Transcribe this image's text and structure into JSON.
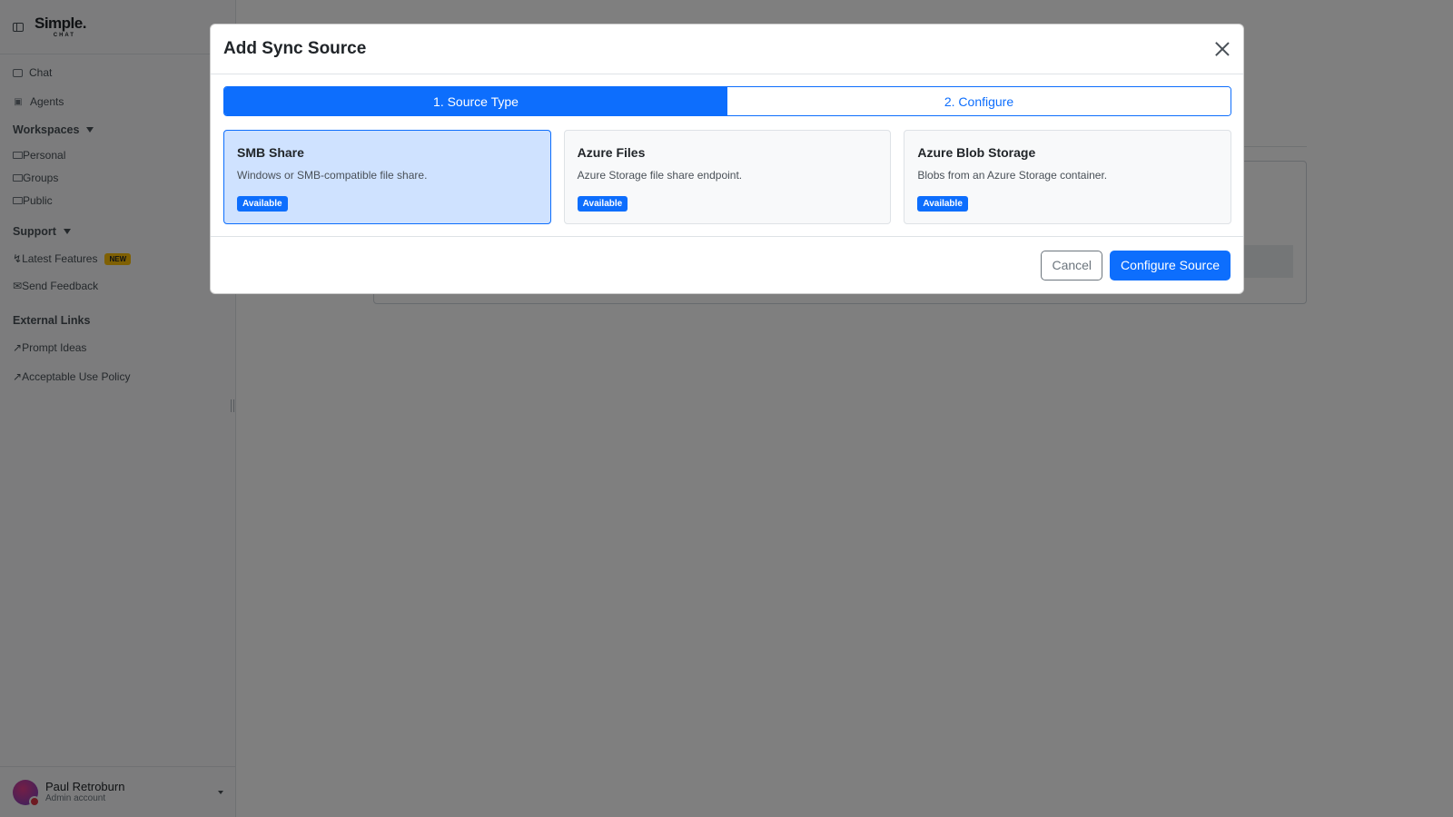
{
  "sidebar": {
    "logo_main": "Simple.",
    "logo_sub": "CHAT",
    "nav": [
      {
        "label": "Chat",
        "icon": "chat-icon"
      },
      {
        "label": "Agents",
        "icon": "robot-icon"
      }
    ],
    "workspaces": {
      "title": "Workspaces",
      "items": [
        {
          "label": "Personal",
          "icon": "folder-icon"
        },
        {
          "label": "Groups",
          "icon": "folder-icon"
        },
        {
          "label": "Public",
          "icon": "folder-icon"
        }
      ]
    },
    "support": {
      "title": "Support",
      "items": [
        {
          "label": "Latest Features",
          "icon": "lightning-icon",
          "badge": "NEW"
        },
        {
          "label": "Send Feedback",
          "icon": "envelope-icon"
        }
      ]
    },
    "external": {
      "title": "External Links",
      "items": [
        {
          "label": "Prompt Ideas",
          "icon": "external-link-icon"
        },
        {
          "label": "Acceptable Use Policy",
          "icon": "external-link-icon"
        }
      ]
    },
    "user": {
      "name": "Paul Retroburn",
      "role": "Admin account"
    }
  },
  "modal": {
    "title": "Add Sync Source",
    "steps": [
      {
        "label": "1. Source Type",
        "active": true
      },
      {
        "label": "2. Configure",
        "active": false
      }
    ],
    "cards": [
      {
        "title": "SMB Share",
        "description": "Windows or SMB-compatible file share.",
        "badge": "Available",
        "selected": true
      },
      {
        "title": "Azure Files",
        "description": "Azure Storage file share endpoint.",
        "badge": "Available",
        "selected": false
      },
      {
        "title": "Azure Blob Storage",
        "description": "Blobs from an Azure Storage container.",
        "badge": "Available",
        "selected": false
      }
    ],
    "cancel_label": "Cancel",
    "configure_label": "Configure Source"
  },
  "colors": {
    "primary": "#0d6efd",
    "selected_card": "#cfe2ff",
    "new_badge": "#ffc107",
    "backdrop": "rgba(0,0,0,0.5)"
  }
}
